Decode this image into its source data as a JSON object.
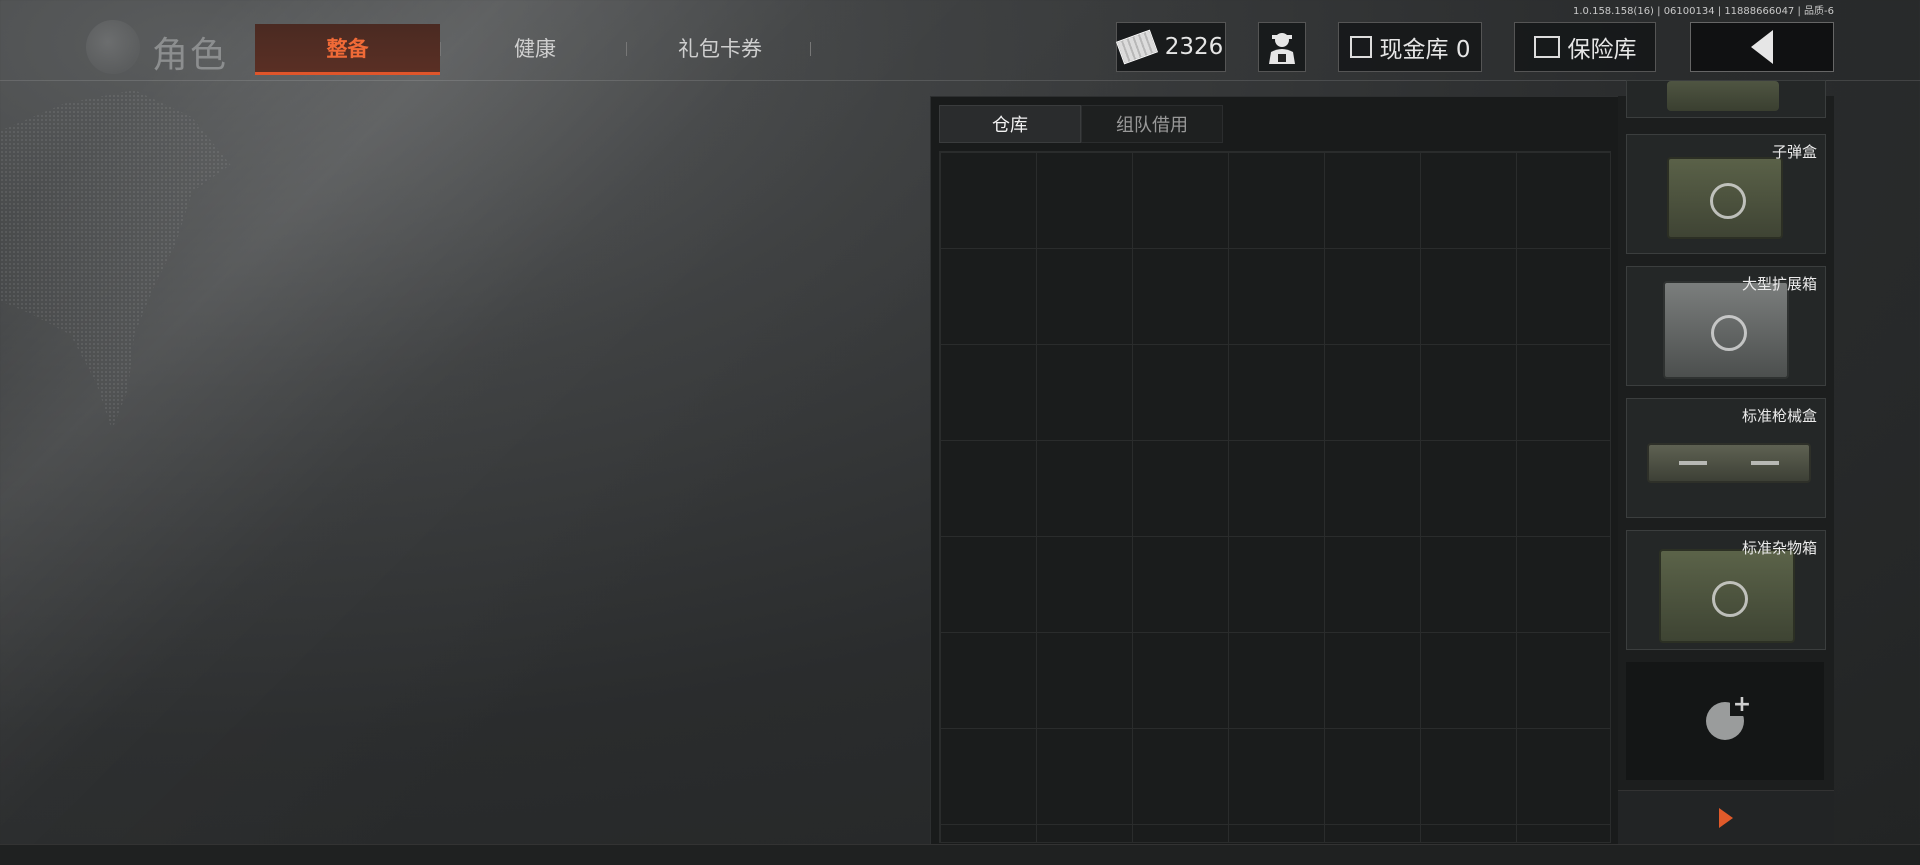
{
  "version_text": "1.0.158.158(16) | 06100134 | 11888666047 | 品质-6",
  "header": {
    "logo_icon": "globe-emblem-icon",
    "title": "角色",
    "tabs": [
      {
        "label": "整备",
        "active": true
      },
      {
        "label": "健康",
        "active": false
      },
      {
        "label": "礼包卡券",
        "active": false
      }
    ]
  },
  "hud": {
    "cash_icon": "cash-bundle-icon",
    "cash_amount": "2326",
    "merchant_icon": "soldier-avatar-icon",
    "cash_vault_icon": "vault-card-icon",
    "cash_vault_label": "现金库 0",
    "safe_icon": "safe-icon",
    "safe_label": "保险库",
    "back_icon": "back-arrow-icon"
  },
  "inventory": {
    "tabs": [
      {
        "label": "仓库",
        "active": true
      },
      {
        "label": "组队借用",
        "active": false
      }
    ],
    "grid": {
      "columns": 7,
      "rows": 7,
      "items": []
    }
  },
  "containers": [
    {
      "label": "",
      "icon": "container-box-icon",
      "partial": true
    },
    {
      "label": "子弹盒",
      "icon": "ammo-box-icon"
    },
    {
      "label": "大型扩展箱",
      "icon": "large-expansion-case-icon"
    },
    {
      "label": "标准枪械盒",
      "icon": "gun-case-icon"
    },
    {
      "label": "标准杂物箱",
      "icon": "misc-case-icon"
    }
  ],
  "add_container_icon": "gear-add-icon",
  "more_icon": "play-arrow-icon",
  "colors": {
    "accent": "#e0552a",
    "panel": "#191b1b"
  }
}
